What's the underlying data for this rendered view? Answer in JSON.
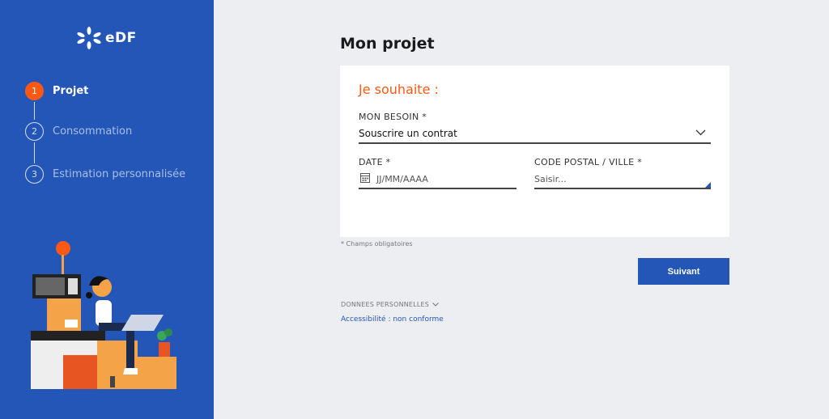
{
  "sidebar": {
    "logo_text": "eDF",
    "steps": [
      {
        "number": "1",
        "label": "Projet"
      },
      {
        "number": "2",
        "label": "Consommation"
      },
      {
        "number": "3",
        "label": "Estimation personnalisée"
      }
    ]
  },
  "main": {
    "title": "Mon projet",
    "card_title": "Je souhaite :",
    "besoin": {
      "label": "MON BESOIN *",
      "value": "Souscrire un contrat"
    },
    "date": {
      "label": "DATE *",
      "placeholder": "JJ/MM/AAAA"
    },
    "postal": {
      "label": "CODE POSTAL / VILLE *",
      "placeholder": "Saisir..."
    },
    "required_note": "* Champs obligatoires",
    "next_button": "Suivant",
    "donnees_personnelles": "DONNEES PERSONNELLES",
    "accessibility": "Accessibilité : non conforme"
  },
  "colors": {
    "brand_blue": "#2456b8",
    "accent_orange": "#fe5815"
  }
}
